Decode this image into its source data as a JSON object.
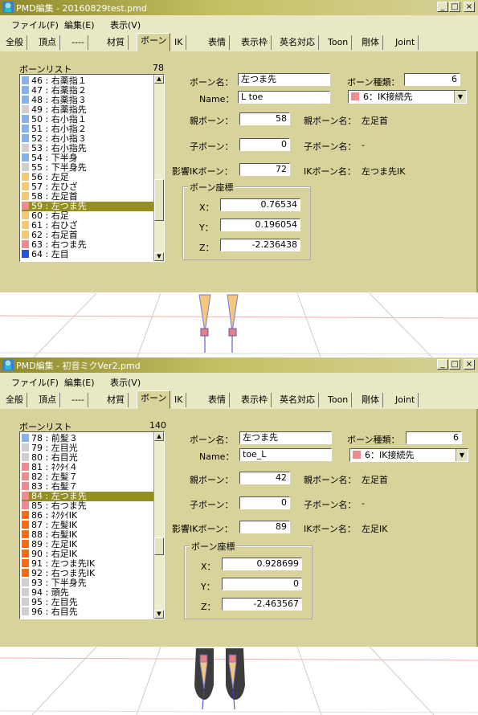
{
  "windows": [
    {
      "title": "PMD編集 - 20160829test.pmd",
      "menus": [
        "ファイル(F)",
        "編集(E)",
        "表示(V)"
      ],
      "tabs": [
        "全般",
        "頂点",
        "----",
        "材質",
        "ボーン",
        "IK",
        "表情",
        "表示枠",
        "英名対応",
        "Toon",
        "剛体",
        "Joint"
      ],
      "active_tab": 4,
      "list_title": "ボーンリスト",
      "list_count": "78",
      "bones": [
        {
          "label": "46 : 右薬指１",
          "color": "#85b3ee"
        },
        {
          "label": "47 : 右薬指２",
          "color": "#85b3ee"
        },
        {
          "label": "48 : 右薬指３",
          "color": "#85b3ee"
        },
        {
          "label": "49 : 右薬指先",
          "color": "#cfcfcf"
        },
        {
          "label": "50 : 右小指１",
          "color": "#85b3ee"
        },
        {
          "label": "51 : 右小指２",
          "color": "#85b3ee"
        },
        {
          "label": "52 : 右小指３",
          "color": "#85b3ee"
        },
        {
          "label": "53 : 右小指先",
          "color": "#cfcfcf"
        },
        {
          "label": "54 : 下半身",
          "color": "#85b3ee"
        },
        {
          "label": "55 : 下半身先",
          "color": "#cfcfcf"
        },
        {
          "label": "56 : 左足",
          "color": "#f7c86e"
        },
        {
          "label": "57 : 左ひざ",
          "color": "#f7c86e"
        },
        {
          "label": "58 : 左足首",
          "color": "#f7c86e"
        },
        {
          "label": "59 : 左つま先",
          "color": "#f08a8f"
        },
        {
          "label": "60 : 右足",
          "color": "#f7c86e"
        },
        {
          "label": "61 : 右ひざ",
          "color": "#f7c86e"
        },
        {
          "label": "62 : 右足首",
          "color": "#f7c86e"
        },
        {
          "label": "63 : 右つま先",
          "color": "#f08a8f"
        },
        {
          "label": "64 : 左目",
          "color": "#2154e3"
        }
      ],
      "selected_index": 13,
      "bone_name_label": "ボーン名：",
      "bone_name": "左つま先",
      "bone_type_label": "ボーン種類：",
      "bone_type_value": "6",
      "name_label": "Name：",
      "name_en": "L toe",
      "type_select": "6：IK接続先",
      "type_color": "#f08a8f",
      "parent_label": "親ボーン：",
      "parent_value": "58",
      "parent_name_label": "親ボーン名：",
      "parent_name": "左足首",
      "child_label": "子ボーン：",
      "child_value": "0",
      "child_name_label": "子ボーン名：",
      "child_name": "-",
      "ik_label": "影響IKボーン：",
      "ik_value": "72",
      "ik_name_label": "IKボーン名：",
      "ik_name": "左つま先IK",
      "coords_title": "ボーン座標",
      "x_label": "X：",
      "x": "0.76534",
      "y_label": "Y：",
      "y": "0.196054",
      "z_label": "Z：",
      "z": "-2.236438"
    },
    {
      "title": "PMD編集 - 初音ミクVer2.pmd",
      "menus": [
        "ファイル(F)",
        "編集(E)",
        "表示(V)"
      ],
      "tabs": [
        "全般",
        "頂点",
        "----",
        "材質",
        "ボーン",
        "IK",
        "表情",
        "表示枠",
        "英名対応",
        "Toon",
        "剛体",
        "Joint"
      ],
      "active_tab": 4,
      "list_title": "ボーンリスト",
      "list_count": "140",
      "bones": [
        {
          "label": "78 : 前髪３",
          "color": "#85b3ee"
        },
        {
          "label": "79 : 左目光",
          "color": "#cfcfcf"
        },
        {
          "label": "80 : 右目光",
          "color": "#cfcfcf"
        },
        {
          "label": "81 : ﾈｸﾀｲ４",
          "color": "#f08a8f"
        },
        {
          "label": "82 : 左髪７",
          "color": "#f08a8f"
        },
        {
          "label": "83 : 右髪７",
          "color": "#f08a8f"
        },
        {
          "label": "84 : 左つま先",
          "color": "#f08a8f"
        },
        {
          "label": "85 : 右つま先",
          "color": "#f08a8f"
        },
        {
          "label": "86 : ﾈｸﾀｲIK",
          "color": "#ff6a10"
        },
        {
          "label": "87 : 左髪IK",
          "color": "#ff6a10"
        },
        {
          "label": "88 : 右髪IK",
          "color": "#ff6a10"
        },
        {
          "label": "89 : 左足IK",
          "color": "#ff6a10"
        },
        {
          "label": "90 : 右足IK",
          "color": "#ff6a10"
        },
        {
          "label": "91 : 左つま先IK",
          "color": "#ff6a10"
        },
        {
          "label": "92 : 右つま先IK",
          "color": "#ff6a10"
        },
        {
          "label": "93 : 下半身先",
          "color": "#cfcfcf"
        },
        {
          "label": "94 : 頭先",
          "color": "#cfcfcf"
        },
        {
          "label": "95 : 左目先",
          "color": "#cfcfcf"
        },
        {
          "label": "96 : 右目先",
          "color": "#cfcfcf"
        }
      ],
      "selected_index": 6,
      "bone_name_label": "ボーン名：",
      "bone_name": "左つま先",
      "bone_type_label": "ボーン種類：",
      "bone_type_value": "6",
      "name_label": "Name：",
      "name_en": "toe_L",
      "type_select": "6：IK接続先",
      "type_color": "#f08a8f",
      "parent_label": "親ボーン：",
      "parent_value": "42",
      "parent_name_label": "親ボーン名：",
      "parent_name": "左足首",
      "child_label": "子ボーン：",
      "child_value": "0",
      "child_name_label": "子ボーン名：",
      "child_name": "-",
      "ik_label": "影響IKボーン：",
      "ik_value": "89",
      "ik_name_label": "IKボーン名：",
      "ik_name": "左足IK",
      "coords_title": "ボーン座標",
      "x_label": "X：",
      "x": "0.928699",
      "y_label": "Y：",
      "y": "0",
      "z_label": "Z：",
      "z": "-2.463567"
    }
  ],
  "titlebar_buttons": {
    "minimize": "_",
    "maximize": "□",
    "close": "×"
  },
  "scroll_arrows": {
    "up": "▲",
    "down": "▼",
    "dropdown": "▼"
  },
  "colors": {
    "panel": "#d7d39a",
    "selection": "#948f20",
    "title_gradient_start": "#8e8a2c"
  }
}
